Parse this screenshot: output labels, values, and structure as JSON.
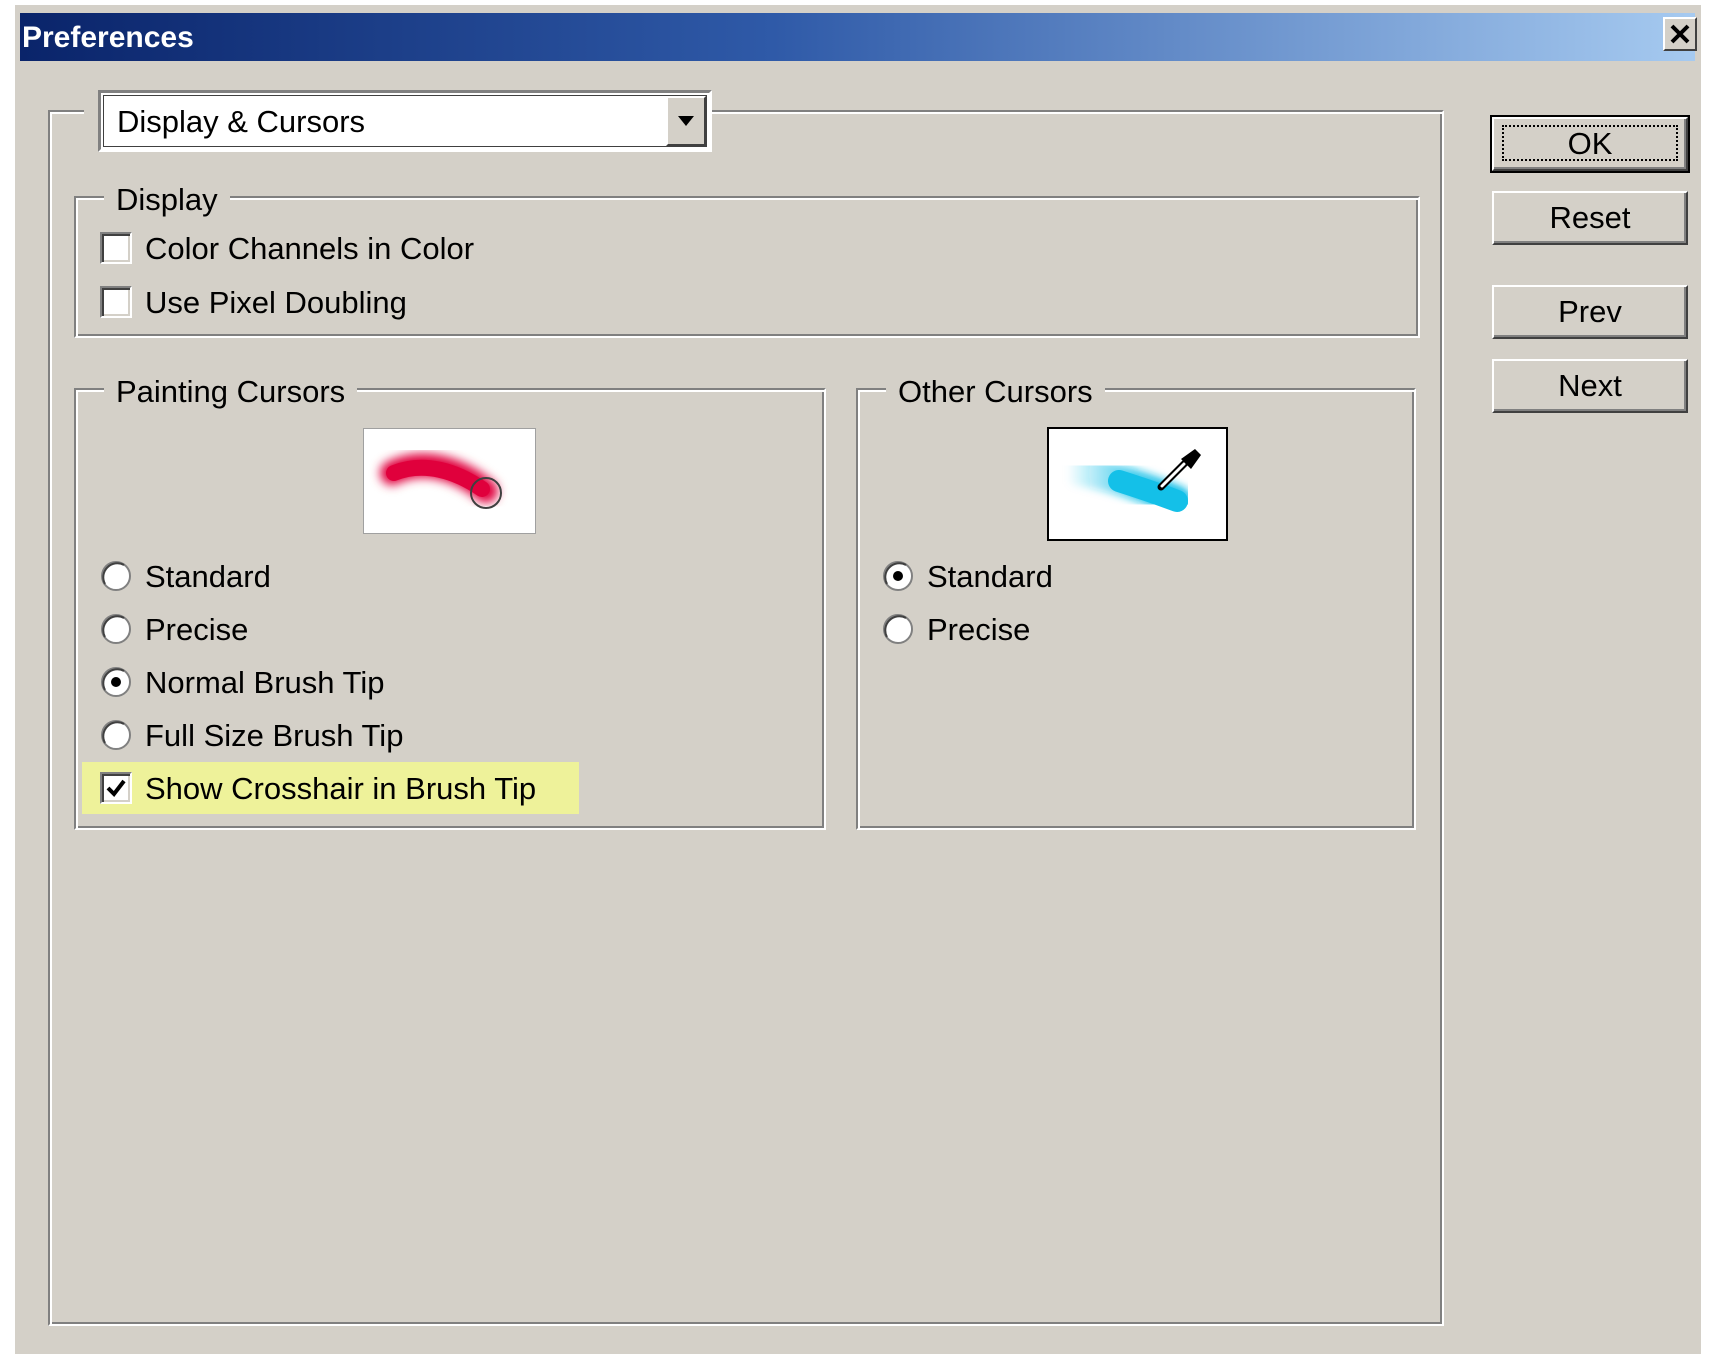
{
  "window": {
    "title": "Preferences"
  },
  "section_select": {
    "value": "Display & Cursors"
  },
  "display_group": {
    "legend": "Display",
    "options": [
      {
        "label": "Color Channels in Color",
        "checked": false
      },
      {
        "label": "Use Pixel Doubling",
        "checked": false
      }
    ]
  },
  "painting_cursors": {
    "legend": "Painting Cursors",
    "options": [
      {
        "label": "Standard",
        "selected": false
      },
      {
        "label": "Precise",
        "selected": false
      },
      {
        "label": "Normal Brush Tip",
        "selected": true
      },
      {
        "label": "Full Size Brush Tip",
        "selected": false
      }
    ],
    "crosshair": {
      "label": "Show Crosshair in Brush Tip",
      "checked": true,
      "highlight_color": "#eef29a"
    }
  },
  "other_cursors": {
    "legend": "Other Cursors",
    "options": [
      {
        "label": "Standard",
        "selected": true
      },
      {
        "label": "Precise",
        "selected": false
      }
    ]
  },
  "buttons": {
    "ok": "OK",
    "reset": "Reset",
    "prev": "Prev",
    "next": "Next"
  },
  "colors": {
    "dialog_bg": "#d4d0c8",
    "title_gradient_start": "#0a246a",
    "title_gradient_end": "#a6caf0",
    "brush_red": "#e0003c",
    "brush_cyan": "#14c0e8"
  }
}
